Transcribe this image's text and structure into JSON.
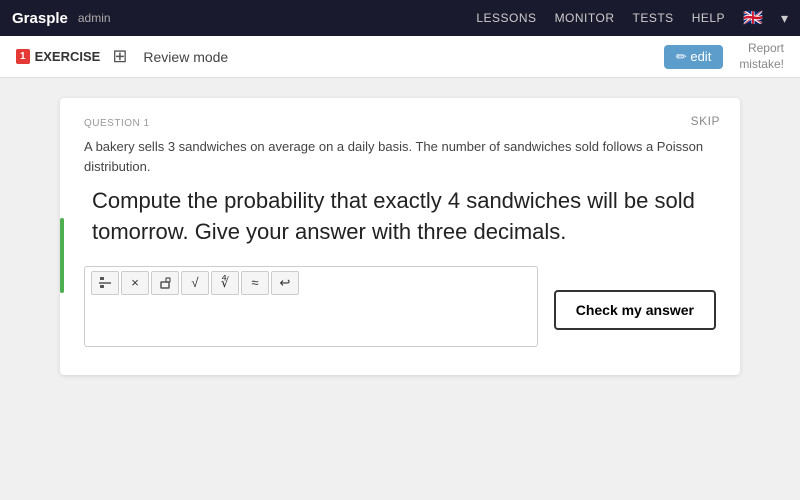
{
  "navbar": {
    "brand": "Grasple",
    "admin_label": "admin",
    "links": [
      "LESSONS",
      "MONITOR",
      "TESTS",
      "HELP"
    ],
    "flag_emoji": "🇬🇧"
  },
  "subtoolbar": {
    "exercise_icon_label": "1",
    "exercise_label": "EXERCISE",
    "review_mode_label": "Review mode",
    "edit_button_label": "✏ edit",
    "report_label": "Report\nmistake!"
  },
  "card": {
    "question_label": "QUESTION 1",
    "skip_label": "SKIP",
    "context_text": "A bakery sells 3 sandwiches on average on a daily basis. The number of sandwiches sold follows a Poisson distribution.",
    "question_text": "Compute the probability that exactly 4 sandwiches will be sold tomorrow. Give your answer with three decimals.",
    "math_buttons": [
      "□",
      "×",
      "■",
      "√□",
      "∜□",
      "≡",
      "↩"
    ],
    "input_placeholder": "",
    "check_answer_label": "Check my answer"
  }
}
